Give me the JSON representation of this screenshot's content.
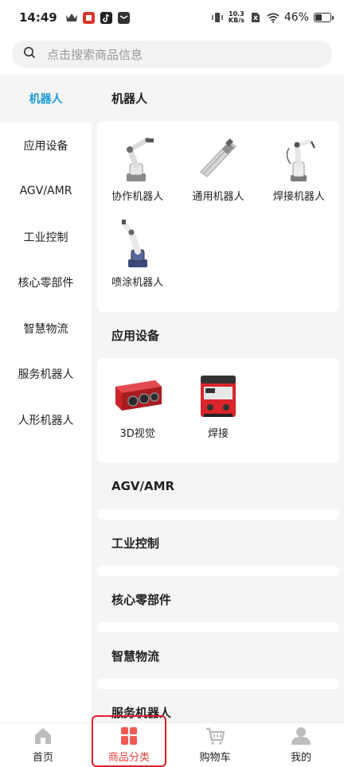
{
  "status_bar": {
    "time": "14:49",
    "net_speed_value": "10.3",
    "net_speed_unit": "KB/s",
    "battery": "46%",
    "battery_level": 0.46
  },
  "search": {
    "placeholder": "点击搜索商品信息"
  },
  "sidebar": {
    "items": [
      {
        "label": "机器人",
        "active": true
      },
      {
        "label": "应用设备"
      },
      {
        "label": "AGV/AMR"
      },
      {
        "label": "工业控制"
      },
      {
        "label": "核心零部件"
      },
      {
        "label": "智慧物流"
      },
      {
        "label": "服务机器人"
      },
      {
        "label": "人形机器人"
      }
    ]
  },
  "sections": [
    {
      "title": "机器人",
      "products": [
        {
          "label": "协作机器人",
          "icon": "robot-arm-icon"
        },
        {
          "label": "通用机器人",
          "icon": "linear-robot-icon"
        },
        {
          "label": "焊接机器人",
          "icon": "welding-robot-icon"
        },
        {
          "label": "喷涂机器人",
          "icon": "painting-robot-icon"
        }
      ]
    },
    {
      "title": "应用设备",
      "products": [
        {
          "label": "3D视觉",
          "icon": "3d-camera-icon"
        },
        {
          "label": "焊接",
          "icon": "welder-machine-icon"
        }
      ]
    },
    {
      "title": "AGV/AMR",
      "products": []
    },
    {
      "title": "工业控制",
      "products": []
    },
    {
      "title": "核心零部件",
      "products": []
    },
    {
      "title": "智慧物流",
      "products": []
    },
    {
      "title": "服务机器人",
      "products": []
    }
  ],
  "tabbar": {
    "tabs": [
      {
        "label": "首页",
        "icon": "home-icon"
      },
      {
        "label": "商品分类",
        "icon": "category-icon",
        "active": true
      },
      {
        "label": "购物车",
        "icon": "cart-icon"
      },
      {
        "label": "我的",
        "icon": "profile-icon"
      }
    ]
  },
  "colors": {
    "accent": "#1a9ad6",
    "tab_active": "#e8463f",
    "highlight_box": "#e41e2a"
  }
}
